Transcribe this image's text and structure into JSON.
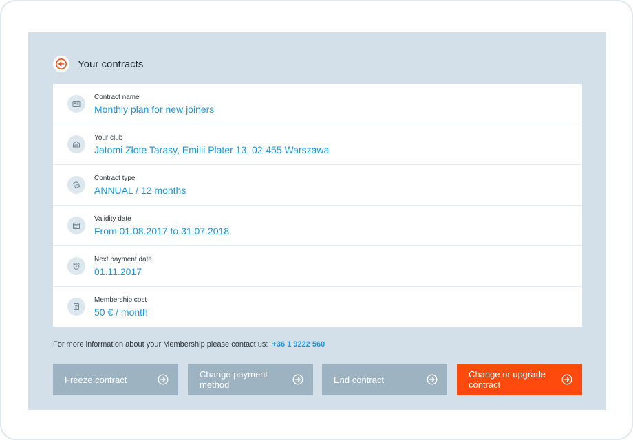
{
  "header": {
    "title": "Your contracts"
  },
  "details": [
    {
      "label": "Contract name",
      "value": "Monthly plan for new joiners",
      "icon": "id-card-icon"
    },
    {
      "label": "Your club",
      "value": "Jatomi Złote Tarasy, Emilii Plater 13, 02-455 Warszawa",
      "icon": "building-icon"
    },
    {
      "label": "Contract type",
      "value": "ANNUAL / 12 months",
      "icon": "contract-icon"
    },
    {
      "label": "Validity date",
      "value": "From 01.08.2017 to 31.07.2018",
      "icon": "calendar-icon"
    },
    {
      "label": "Next payment date",
      "value": "01.11.2017",
      "icon": "alarm-clock-icon"
    },
    {
      "label": "Membership cost",
      "value": "50 € / month",
      "icon": "cost-icon"
    }
  ],
  "info": {
    "text": "For more information about your Membership please contact us:",
    "phone": "+36 1 9222 560"
  },
  "actions": {
    "freeze": "Freeze contract",
    "change_payment": "Change payment method",
    "end": "End contract",
    "upgrade": "Change or upgrade contract"
  },
  "colors": {
    "accent": "#ff4a0e",
    "link": "#1d95d6",
    "panel_bg": "#d4e0e9",
    "button_bg": "#9db3c2"
  }
}
